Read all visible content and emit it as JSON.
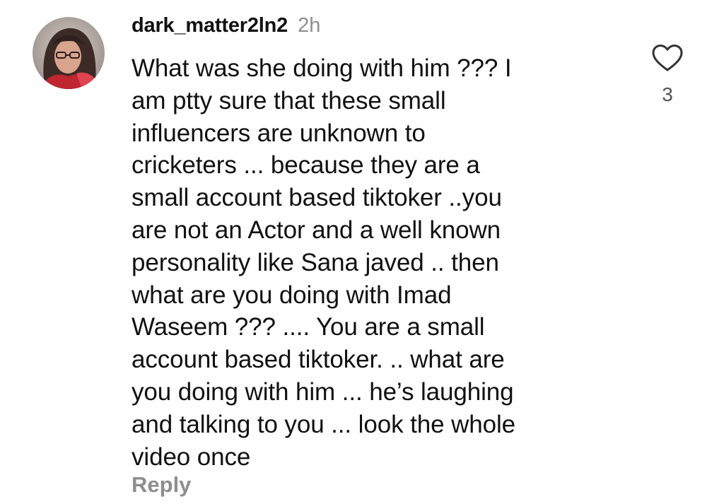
{
  "comment": {
    "username": "dark_matter2ln2",
    "time": "2h",
    "text": "What was she doing with him ??? I\nam ptty sure that these small\ninfluencers are unknown to\ncricketers ... because they are a\nsmall account based tiktoker ..you\nare not an Actor and a well known\npersonality like Sana javed .. then\nwhat  are you doing with Imad\nWaseem ??? .... You are a small\naccount based tiktoker. .. what are\nyou doing with him ... he’s laughing\nand talking to you ... look the whole\nvideo once",
    "reply_label": "Reply",
    "like_count": "3",
    "like_icon": "heart-outline-icon"
  },
  "colors": {
    "text": "#111111",
    "muted": "#8e8e8e",
    "background": "#ffffff"
  }
}
